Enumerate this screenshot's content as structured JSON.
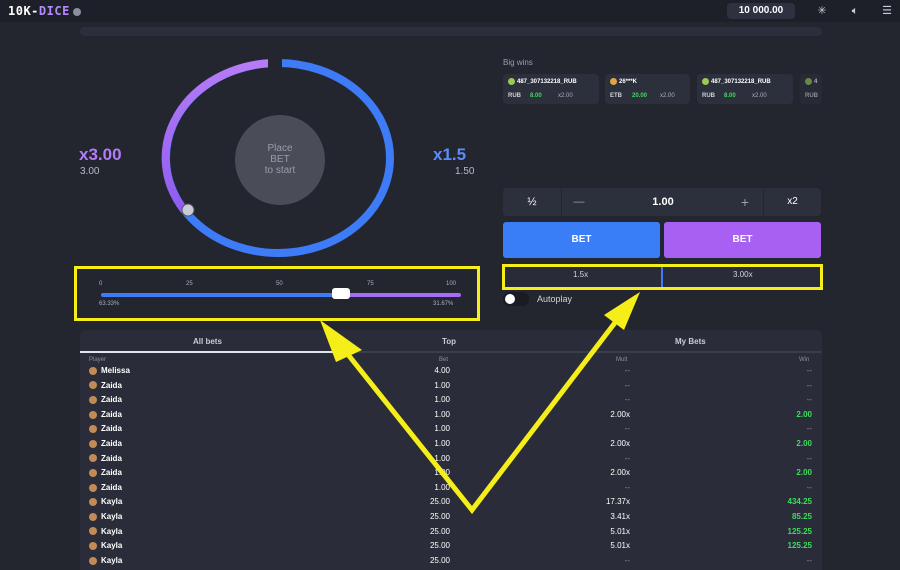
{
  "app": {
    "logo_part1": "10K-",
    "logo_part2": "DICE",
    "balance": "10 000.00",
    "icons": [
      "info-icon",
      "snowflake-icon",
      "sound-icon",
      "menu-icon"
    ]
  },
  "dice": {
    "left_mult": "x3.00",
    "left_sub": "3.00",
    "right_mult": "x1.5",
    "right_sub": "1.50",
    "center_line1": "Place",
    "center_line2": "BET",
    "center_line3": "to start",
    "slider": {
      "ticks": [
        "0",
        "25",
        "50",
        "75",
        "100"
      ],
      "value": 66.67,
      "left_pct": "63.33%",
      "right_pct": "31.67%"
    }
  },
  "big_wins": {
    "title": "Big wins",
    "cards": [
      {
        "name": "487_307132218_RUB",
        "currency": "RUB",
        "amount": "8.00",
        "mult": "x2.00"
      },
      {
        "name": "26***K",
        "currency": "ETB",
        "amount": "20.00",
        "mult": "x2.00"
      },
      {
        "name": "487_307132218_RUB",
        "currency": "RUB",
        "amount": "8.00",
        "mult": "x2.00"
      },
      {
        "name": "4",
        "currency": "RUB",
        "amount": "",
        "mult": ""
      }
    ]
  },
  "stake": {
    "half": "½",
    "minus": "—",
    "amount": "1.00",
    "plus": "+",
    "double": "x2"
  },
  "bet_buttons": {
    "left": "BET",
    "right": "BET",
    "left_target": "1.5x",
    "right_target": "3.00x"
  },
  "autoplay": "Autoplay",
  "table": {
    "tabs": [
      "All bets",
      "Top",
      "My Bets"
    ],
    "headers": {
      "player": "Player",
      "bet": "Bet",
      "mult": "Mult",
      "win": "Win"
    },
    "rows": [
      {
        "player": "Melissa",
        "bet": "4.00",
        "mult": "--",
        "win": "--"
      },
      {
        "player": "Zaida",
        "bet": "1.00",
        "mult": "--",
        "win": "--"
      },
      {
        "player": "Zaida",
        "bet": "1.00",
        "mult": "--",
        "win": "--"
      },
      {
        "player": "Zaida",
        "bet": "1.00",
        "mult": "2.00x",
        "win": "2.00"
      },
      {
        "player": "Zaida",
        "bet": "1.00",
        "mult": "--",
        "win": "--"
      },
      {
        "player": "Zaida",
        "bet": "1.00",
        "mult": "2.00x",
        "win": "2.00"
      },
      {
        "player": "Zaida",
        "bet": "1.00",
        "mult": "--",
        "win": "--"
      },
      {
        "player": "Zaida",
        "bet": "1.00",
        "mult": "2.00x",
        "win": "2.00"
      },
      {
        "player": "Zaida",
        "bet": "1.00",
        "mult": "--",
        "win": "--"
      },
      {
        "player": "Kayla",
        "bet": "25.00",
        "mult": "17.37x",
        "win": "434.25"
      },
      {
        "player": "Kayla",
        "bet": "25.00",
        "mult": "3.41x",
        "win": "85.25"
      },
      {
        "player": "Kayla",
        "bet": "25.00",
        "mult": "5.01x",
        "win": "125.25"
      },
      {
        "player": "Kayla",
        "bet": "25.00",
        "mult": "5.01x",
        "win": "125.25"
      },
      {
        "player": "Kayla",
        "bet": "25.00",
        "mult": "--",
        "win": "--"
      }
    ]
  },
  "colors": {
    "purple": "#a56cf5",
    "blue": "#3d7bf7",
    "green": "#3ddc5b",
    "highlight": "#f6ee19"
  }
}
